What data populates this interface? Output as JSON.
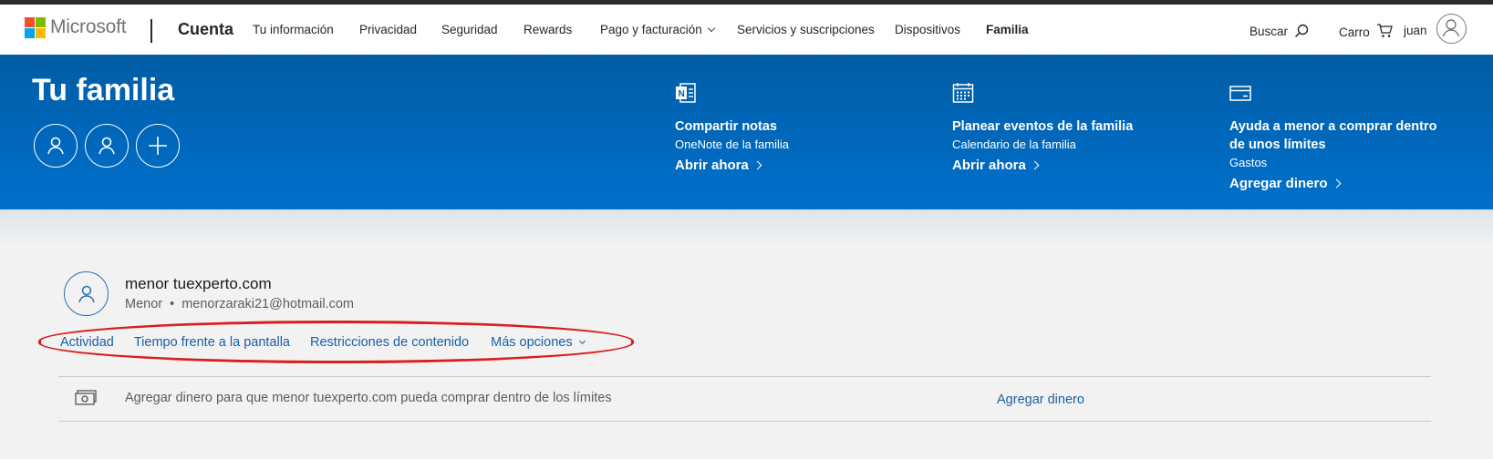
{
  "header": {
    "brand": "Microsoft",
    "section": "Cuenta",
    "nav": [
      {
        "label": "Tu información"
      },
      {
        "label": "Privacidad"
      },
      {
        "label": "Seguridad"
      },
      {
        "label": "Rewards"
      },
      {
        "label": "Pago y facturación"
      },
      {
        "label": "Servicios y suscripciones"
      },
      {
        "label": "Dispositivos"
      },
      {
        "label": "Familia",
        "active": true
      }
    ],
    "search_label": "Buscar",
    "cart_label": "Carro",
    "user_label": "juan"
  },
  "banner": {
    "title": "Tu familia",
    "features": [
      {
        "icon": "onenote-icon",
        "title": "Compartir notas",
        "subtitle": "OneNote de la familia",
        "link": "Abrir ahora"
      },
      {
        "icon": "calendar-icon",
        "title": "Planear eventos de la familia",
        "subtitle": "Calendario de la familia",
        "link": "Abrir ahora"
      },
      {
        "icon": "card-icon",
        "title_line1": "Ayuda a menor a comprar dentro",
        "title_line2": "de unos límites",
        "subtitle": "Gastos",
        "link": "Agregar dinero"
      }
    ]
  },
  "child": {
    "name": "menor tuexperto.com",
    "role": "Menor",
    "email": "menorzaraki21@hotmail.com",
    "tabs": [
      {
        "label": "Actividad"
      },
      {
        "label": "Tiempo frente a la pantalla"
      },
      {
        "label": "Restricciones de contenido"
      },
      {
        "label": "Más opciones"
      }
    ],
    "money_row": {
      "text": "Agregar dinero para que menor tuexperto.com pueda comprar dentro de los límites",
      "link": "Agregar dinero"
    }
  },
  "colors": {
    "banner": "#0067b8",
    "link": "#1a5fa8",
    "highlight": "#d91e1e"
  }
}
